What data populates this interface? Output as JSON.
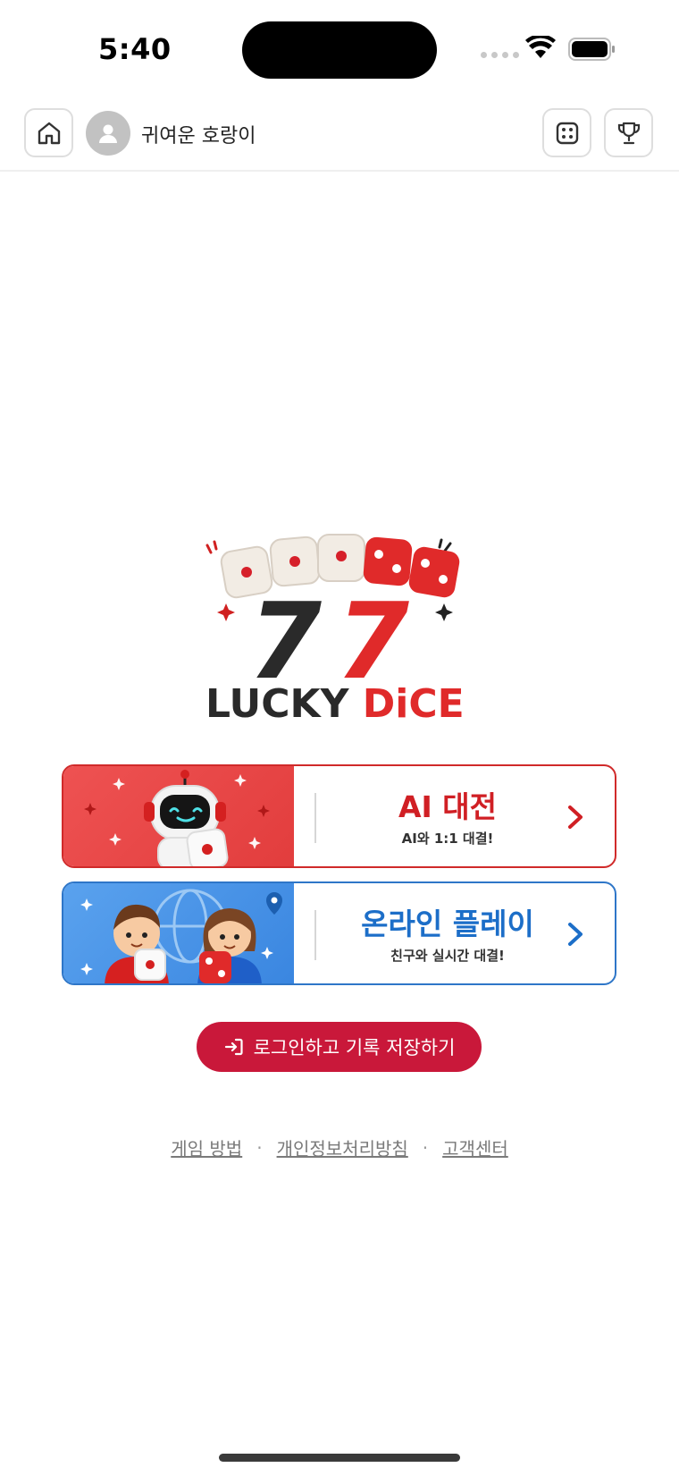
{
  "status_bar": {
    "time": "5:40"
  },
  "header": {
    "username": "귀여운 호랑이",
    "home_icon": "home-icon",
    "avatar_icon": "user-icon",
    "dice_icon": "dice-icon",
    "trophy_icon": "trophy-icon"
  },
  "logo": {
    "number": "77",
    "word_black": "LUCKY ",
    "word_red": "DiCE"
  },
  "modes": [
    {
      "title": "AI 대전",
      "subtitle": "AI와 1:1 대결!",
      "color": "#d01f24",
      "icon": "robot-icon"
    },
    {
      "title": "온라인 플레이",
      "subtitle": "친구와 실시간 대결!",
      "color": "#1c6ec8",
      "icon": "kids-globe-icon"
    }
  ],
  "login_button": {
    "label": "로그인하고 기록 저장하기",
    "icon": "login-icon",
    "color": "#c9183a"
  },
  "footer": {
    "links": [
      "게임 방법",
      "개인정보처리방침",
      "고객센터"
    ],
    "separator": "·"
  }
}
